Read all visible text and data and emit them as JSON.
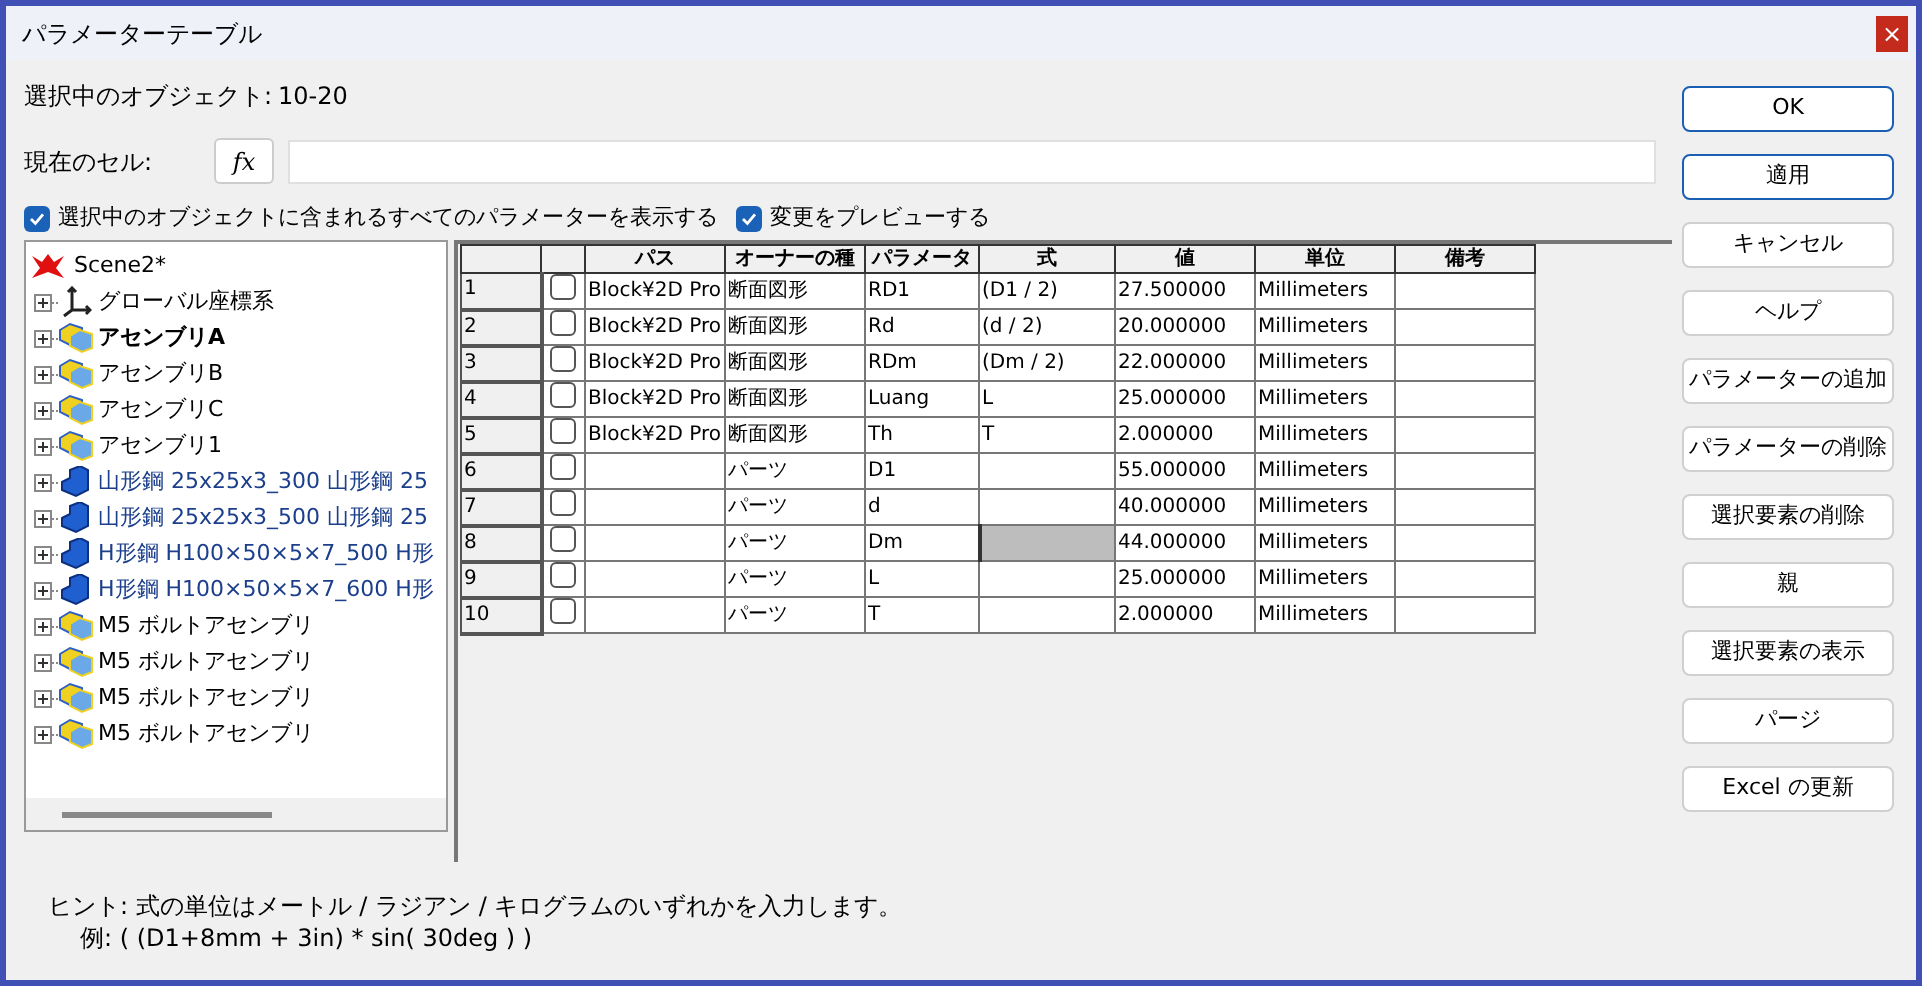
{
  "window": {
    "title": "パラメーターテーブル",
    "close": "×"
  },
  "selected_object": {
    "label": "選択中のオブジェクト:",
    "value": "10-20"
  },
  "current_cell": {
    "label": "現在のセル:",
    "fx": "fx"
  },
  "options": [
    {
      "label": "選択中のオブジェクトに含まれるすべてのパラメーターを表示する",
      "checked": true
    },
    {
      "label": "変更をプレビューする",
      "checked": true
    }
  ],
  "tree": {
    "root": "Scene2*",
    "items": [
      {
        "kind": "origin",
        "label": "グローバル座標系",
        "bold": false
      },
      {
        "kind": "assembly",
        "label": "アセンブリA",
        "bold": true
      },
      {
        "kind": "assembly",
        "label": "アセンブリB",
        "bold": false
      },
      {
        "kind": "assembly",
        "label": "アセンブリC",
        "bold": false
      },
      {
        "kind": "assembly",
        "label": "アセンブリ1",
        "bold": false
      },
      {
        "kind": "part",
        "label": "山形鋼 25x25x3_300 山形鋼 25",
        "bold": false
      },
      {
        "kind": "part",
        "label": "山形鋼 25x25x3_500 山形鋼 25",
        "bold": false
      },
      {
        "kind": "part",
        "label": "H形鋼 H100×50×5×7_500 H形",
        "bold": false
      },
      {
        "kind": "part",
        "label": "H形鋼 H100×50×5×7_600 H形",
        "bold": false
      },
      {
        "kind": "assembly",
        "label": "M5 ボルトアセンブリ",
        "bold": false
      },
      {
        "kind": "assembly",
        "label": "M5 ボルトアセンブリ",
        "bold": false
      },
      {
        "kind": "assembly",
        "label": "M5 ボルトアセンブリ",
        "bold": false
      },
      {
        "kind": "assembly",
        "label": "M5 ボルトアセンブリ",
        "bold": false
      }
    ]
  },
  "table": {
    "columns": [
      "パス",
      "オーナーの種",
      "パラメータ",
      "式",
      "値",
      "単位",
      "備考"
    ],
    "rows": [
      {
        "number": "1",
        "checked": false,
        "cells": [
          "Block¥2D Pro",
          "断面図形",
          "RD1",
          "(D1 / 2)",
          "27.500000",
          "Millimeters",
          ""
        ],
        "formula_selected": false
      },
      {
        "number": "2",
        "checked": false,
        "cells": [
          "Block¥2D Pro",
          "断面図形",
          "Rd",
          "(d / 2)",
          "20.000000",
          "Millimeters",
          ""
        ],
        "formula_selected": false
      },
      {
        "number": "3",
        "checked": false,
        "cells": [
          "Block¥2D Pro",
          "断面図形",
          "RDm",
          "(Dm / 2)",
          "22.000000",
          "Millimeters",
          ""
        ],
        "formula_selected": false
      },
      {
        "number": "4",
        "checked": false,
        "cells": [
          "Block¥2D Pro",
          "断面図形",
          "Luang",
          "L",
          "25.000000",
          "Millimeters",
          ""
        ],
        "formula_selected": false
      },
      {
        "number": "5",
        "checked": false,
        "cells": [
          "Block¥2D Pro",
          "断面図形",
          "Th",
          "T",
          "2.000000",
          "Millimeters",
          ""
        ],
        "formula_selected": false
      },
      {
        "number": "6",
        "checked": false,
        "cells": [
          "",
          "パーツ",
          "D1",
          "",
          "55.000000",
          "Millimeters",
          ""
        ],
        "formula_selected": false
      },
      {
        "number": "7",
        "checked": false,
        "cells": [
          "",
          "パーツ",
          "d",
          "",
          "40.000000",
          "Millimeters",
          ""
        ],
        "formula_selected": false
      },
      {
        "number": "8",
        "checked": false,
        "cells": [
          "",
          "パーツ",
          "Dm",
          "",
          "44.000000",
          "Millimeters",
          ""
        ],
        "formula_selected": true
      },
      {
        "number": "9",
        "checked": false,
        "cells": [
          "",
          "パーツ",
          "L",
          "",
          "25.000000",
          "Millimeters",
          ""
        ],
        "formula_selected": false
      },
      {
        "number": "10",
        "checked": false,
        "cells": [
          "",
          "パーツ",
          "T",
          "",
          "2.000000",
          "Millimeters",
          ""
        ],
        "formula_selected": false
      }
    ]
  },
  "buttons": [
    {
      "label": "OK",
      "default": true
    },
    {
      "label": "適用",
      "default": true
    },
    {
      "label": "キャンセル",
      "default": false
    },
    {
      "label": "ヘルプ",
      "default": false
    },
    {
      "label": "パラメーターの追加",
      "default": false
    },
    {
      "label": "パラメーターの削除",
      "default": false
    },
    {
      "label": "選択要素の削除",
      "default": false
    },
    {
      "label": "親",
      "default": false
    },
    {
      "label": "選択要素の表示",
      "default": false
    },
    {
      "label": "パージ",
      "default": false
    },
    {
      "label": "Excel の更新",
      "default": false
    }
  ],
  "hint": [
    "ヒント: 式の単位はメートル / ラジアン / キログラムのいずれかを入力します。",
    "例: ( (D1+8mm + 3in) * sin( 30deg ) )"
  ]
}
